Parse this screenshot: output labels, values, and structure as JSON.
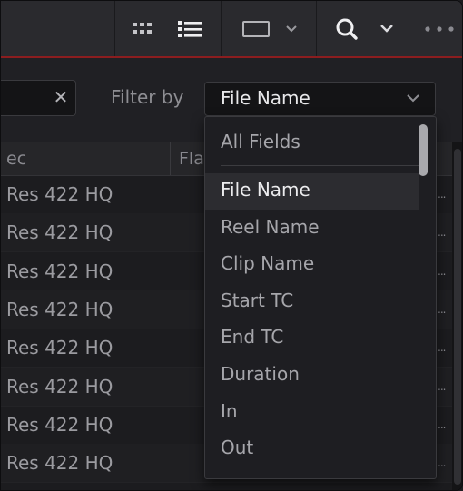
{
  "toolbar": {
    "buttons": [
      {
        "name": "grid-view-icon"
      },
      {
        "name": "list-view-icon"
      },
      {
        "name": "monitor-icon"
      },
      {
        "name": "search-icon"
      },
      {
        "name": "more-options-icon"
      }
    ]
  },
  "filter": {
    "label": "Filter by",
    "selected": "File Name",
    "clear_glyph": "✕"
  },
  "table": {
    "headers": [
      "ec",
      "Fla"
    ],
    "rows": [
      {
        "codec": "Res 422 HQ",
        "more": "..."
      },
      {
        "codec": "Res 422 HQ",
        "more": "..."
      },
      {
        "codec": "Res 422 HQ",
        "more": "..."
      },
      {
        "codec": "Res 422 HQ",
        "more": "..."
      },
      {
        "codec": "Res 422 HQ",
        "more": "..."
      },
      {
        "codec": "Res 422 HQ",
        "more": "..."
      },
      {
        "codec": "Res 422 HQ",
        "more": "..."
      },
      {
        "codec": "Res 422 HQ",
        "more": "..."
      }
    ]
  },
  "dropdown": {
    "first": "All Fields",
    "items": [
      "File Name",
      "Reel Name",
      "Clip Name",
      "Start TC",
      "End TC",
      "Duration",
      "In",
      "Out"
    ],
    "selected_index": 0
  },
  "colors": {
    "accent_line": "#8c1d1f",
    "background": "#1c1c1f"
  }
}
